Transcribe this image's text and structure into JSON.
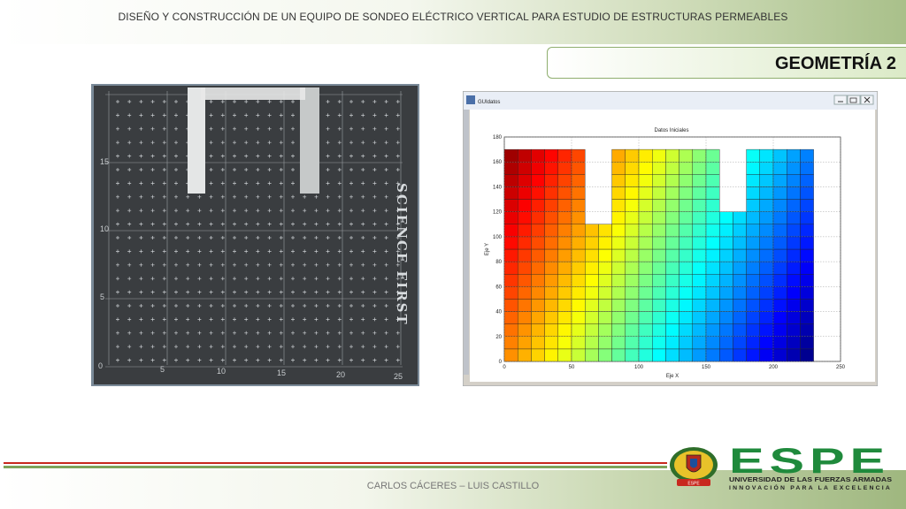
{
  "header": {
    "title": "DISEÑO Y CONSTRUCCIÓN DE UN EQUIPO DE SONDEO ELÉCTRICO VERTICAL PARA ESTUDIO DE ESTRUCTURAS PERMEABLES"
  },
  "slide": {
    "title": "GEOMETRÍA 2"
  },
  "photo": {
    "side_text": "SCIENCE FIRST",
    "x_ticks": [
      "0",
      "5",
      "10",
      "15",
      "20",
      "25"
    ],
    "y_ticks": [
      "5",
      "10",
      "15"
    ]
  },
  "figure": {
    "window_title": "GUIdatos"
  },
  "chart_data": {
    "type": "heatmap",
    "title": "Datos Iniciales",
    "xlabel": "Eje X",
    "ylabel": "Eje Y",
    "xlim": [
      0,
      250
    ],
    "ylim": [
      0,
      180
    ],
    "x_ticks": [
      0,
      50,
      100,
      150,
      200,
      250
    ],
    "y_ticks": [
      0,
      20,
      40,
      60,
      80,
      100,
      120,
      140,
      160,
      180
    ],
    "cell_size": 10,
    "grid": true,
    "colormap": "jet",
    "columns": [
      {
        "x": [
          0,
          60
        ],
        "y_top": 170
      },
      {
        "x": [
          60,
          80
        ],
        "y_top": 110
      },
      {
        "x": [
          80,
          160
        ],
        "y_top": 170
      },
      {
        "x": [
          160,
          180
        ],
        "y_top": 120
      },
      {
        "x": [
          180,
          230
        ],
        "y_top": 170
      }
    ]
  },
  "footer": {
    "authors": "CARLOS CÁCERES – LUIS CASTILLO",
    "logo_text": "ESPE",
    "university": "UNIVERSIDAD DE LAS FUERZAS ARMADAS",
    "motto": "INNOVACIÓN PARA LA EXCELENCIA",
    "seal_banner": "ESPE"
  },
  "colors": {
    "brand_green": "#1f8a3c",
    "accent_red": "#c8281e",
    "band_green": "#7ea35a"
  }
}
